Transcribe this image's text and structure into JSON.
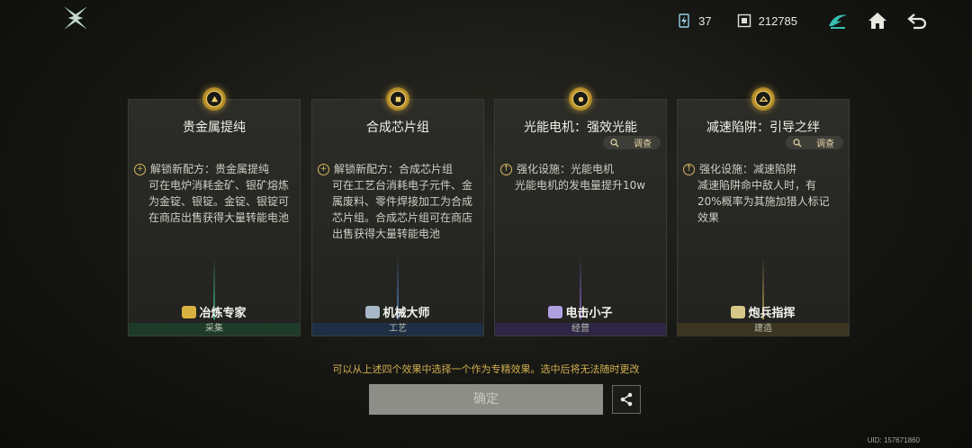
{
  "header": {
    "resource_1": {
      "value": "37",
      "icon": "energy-cell-icon"
    },
    "resource_2": {
      "value": "212785",
      "icon": "currency-icon"
    },
    "icons": [
      "faction-emblem-icon",
      "home-icon",
      "back-icon"
    ]
  },
  "cards": [
    {
      "title": "贵金属提纯",
      "has_inspect": false,
      "inspect_label": "",
      "lead": "解锁新配方：贵金属提纯",
      "body": "可在电炉消耗金矿、银矿熔炼为金锭、银锭。金锭、银锭可在商店出售获得大量转能电池",
      "role": "冶炼专家",
      "footer": "采集",
      "footer_color": "#1e3a28"
    },
    {
      "title": "合成芯片组",
      "has_inspect": false,
      "inspect_label": "",
      "lead": "解锁新配方：合成芯片组",
      "body": "可在工艺台消耗电子元件、金属废料、零件焊接加工为合成芯片组。合成芯片组可在商店出售获得大量转能电池",
      "role": "机械大师",
      "footer": "工艺",
      "footer_color": "#1e2e44"
    },
    {
      "title": "光能电机：强效光能",
      "has_inspect": true,
      "inspect_label": "调查",
      "lead": "强化设施：光能电机",
      "body": "光能电机的发电量提升10w",
      "role": "电击小子",
      "footer": "经营",
      "footer_color": "#2e2644"
    },
    {
      "title": "减速陷阱：引导之绊",
      "has_inspect": true,
      "inspect_label": "调查",
      "lead": "强化设施：减速陷阱",
      "body": "减速陷阱命中敌人时，有20%概率为其施加猎人标记效果",
      "role": "炮兵指挥",
      "footer": "建造",
      "footer_color": "#3a3420"
    }
  ],
  "hint": "可以从上述四个效果中选择一个作为专精效果。选中后将无法随时更改",
  "confirm_label": "确定",
  "uid": "UID: 157671860",
  "colors": {
    "gold": "#d8b860",
    "accent_teal": "#38c0b0"
  }
}
